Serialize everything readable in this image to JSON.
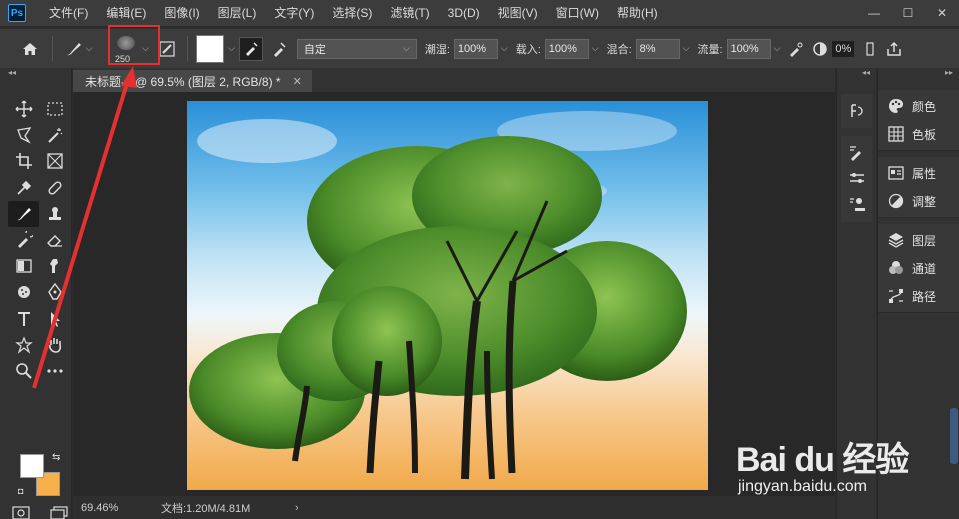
{
  "app": {
    "logo_text": "Ps"
  },
  "menu": {
    "items": [
      "文件(F)",
      "编辑(E)",
      "图像(I)",
      "图层(L)",
      "文字(Y)",
      "选择(S)",
      "滤镜(T)",
      "3D(D)",
      "视图(V)",
      "窗口(W)",
      "帮助(H)"
    ],
    "window_controls": [
      "—",
      "☐",
      "✕"
    ]
  },
  "options": {
    "brush_size": "250",
    "mode_label": "自定",
    "fields": [
      {
        "label": "潮湿:",
        "value": "100%"
      },
      {
        "label": "载入:",
        "value": "100%"
      },
      {
        "label": "混合:",
        "value": "8%"
      },
      {
        "label": "流量:",
        "value": "100%"
      }
    ],
    "angle_value": "0%"
  },
  "document": {
    "tab_title": "未标题-1 @ 69.5% (图层 2, RGB/8) *",
    "tab_close": "✕",
    "zoom": "69.46%",
    "doc_info": "文档:1.20M/4.81M",
    "status_arrow": "›"
  },
  "panels": {
    "groups": [
      [
        {
          "label": "颜色",
          "icon": "palette-icon"
        },
        {
          "label": "色板",
          "icon": "grid-icon"
        }
      ],
      [
        {
          "label": "属性",
          "icon": "properties-icon"
        },
        {
          "label": "调整",
          "icon": "adjust-icon"
        }
      ],
      [
        {
          "label": "图层",
          "icon": "layers-icon"
        },
        {
          "label": "通道",
          "icon": "channels-icon"
        },
        {
          "label": "路径",
          "icon": "paths-icon"
        }
      ]
    ]
  },
  "colors": {
    "foreground": "#ffffff",
    "background": "#f5b04c",
    "annotation": "#e53030"
  },
  "watermark": {
    "main": "Bai du 经验",
    "sub": "jingyan.baidu.com"
  }
}
